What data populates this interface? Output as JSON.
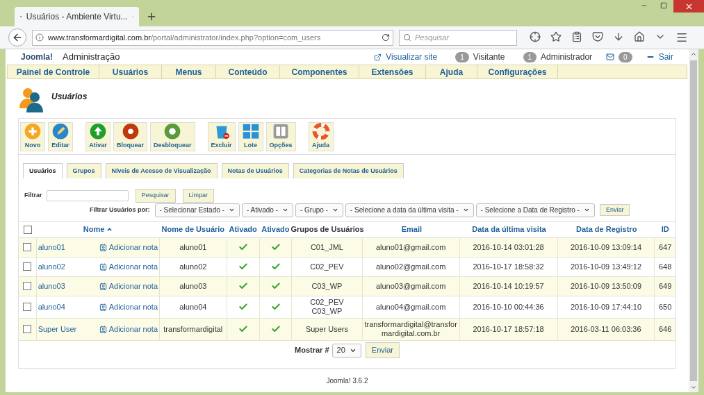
{
  "browser": {
    "tab_title": "Usuários - Ambiente Virtu...",
    "url_host": "www.transformardigital.com.br",
    "url_path": "/portal/administrator/index.php?option=com_users",
    "search_placeholder": "Pesquisar"
  },
  "header": {
    "logo": "Joomla!",
    "title": "Administração",
    "view_site": "Visualizar site",
    "visitors_count": "1",
    "visitors_label": "Visitante",
    "admins_count": "1",
    "admins_label": "Administrador",
    "messages_count": "0",
    "logout": "Sair"
  },
  "menu": [
    "Painel de Controle",
    "Usuários",
    "Menus",
    "Conteúdo",
    "Componentes",
    "Extensões",
    "Ajuda",
    "Configurações"
  ],
  "page_title": "Usuários",
  "toolbar": [
    {
      "label": "Novo",
      "kind": "new"
    },
    {
      "label": "Editar",
      "kind": "edit"
    },
    {
      "label": "Ativar",
      "kind": "activate"
    },
    {
      "label": "Bloquear",
      "kind": "block"
    },
    {
      "label": "Desbloquear",
      "kind": "unblock"
    },
    {
      "label": "Excluir",
      "kind": "delete"
    },
    {
      "label": "Lote",
      "kind": "batch"
    },
    {
      "label": "Opções",
      "kind": "options"
    },
    {
      "label": "Ajuda",
      "kind": "help"
    }
  ],
  "tabs": [
    {
      "label": "Usuários",
      "selected": true
    },
    {
      "label": "Grupos",
      "selected": false
    },
    {
      "label": "Níveis de Acesso de Visualização",
      "selected": false
    },
    {
      "label": "Notas de Usuários",
      "selected": false
    },
    {
      "label": "Categorias de Notas de Usuários",
      "selected": false
    }
  ],
  "filter": {
    "label": "Filtrar",
    "search_button": "Pesquisar",
    "clear_button": "Limpar",
    "by_label": "Filtrar Usuários por:",
    "selects": [
      "- Selecionar Estado -",
      "- Ativado -",
      "- Grupo -",
      "- Selecione a data da última visita -",
      "- Selecione a Data de Registro -"
    ],
    "submit": "Enviar"
  },
  "table": {
    "all_checked": false,
    "columns": [
      {
        "label": "Nome",
        "sorted": true
      },
      {
        "label": "Nome de Usuário",
        "sorted": false
      },
      {
        "label": "Ativado",
        "sorted": false
      },
      {
        "label": "Ativado",
        "sorted": false
      },
      {
        "label": "Grupos de Usuários",
        "sorted": false
      },
      {
        "label": "Email",
        "sorted": false
      },
      {
        "label": "Data da última visita",
        "sorted": false
      },
      {
        "label": "Data de Registro",
        "sorted": false
      },
      {
        "label": "ID",
        "sorted": false
      }
    ],
    "rows": [
      {
        "checked": false,
        "name": "aluno01",
        "note": "Adicionar nota",
        "username": "aluno01",
        "enabled": true,
        "activated": true,
        "groups": [
          "C01_JML"
        ],
        "email": "aluno01@gmail.com",
        "last_visit": "2016-10-14 03:01:28",
        "registered": "2016-10-09 13:09:14",
        "id": "647"
      },
      {
        "checked": false,
        "name": "aluno02",
        "note": "Adicionar nota",
        "username": "aluno02",
        "enabled": true,
        "activated": true,
        "groups": [
          "C02_PEV"
        ],
        "email": "aluno02@gmail.com",
        "last_visit": "2016-10-17 18:58:32",
        "registered": "2016-10-09 13:49:12",
        "id": "648"
      },
      {
        "checked": false,
        "name": "aluno03",
        "note": "Adicionar nota",
        "username": "aluno03",
        "enabled": true,
        "activated": true,
        "groups": [
          "C03_WP"
        ],
        "email": "aluno03@gmail.com",
        "last_visit": "2016-10-14 10:19:57",
        "registered": "2016-10-09 13:50:09",
        "id": "649"
      },
      {
        "checked": false,
        "name": "aluno04",
        "note": "Adicionar nota",
        "username": "aluno04",
        "enabled": true,
        "activated": true,
        "groups": [
          "C02_PEV",
          "C03_WP"
        ],
        "email": "aluno04@gmail.com",
        "last_visit": "2016-10-10 00:44:36",
        "registered": "2016-10-09 17:44:10",
        "id": "650"
      },
      {
        "checked": false,
        "name": "Super User",
        "note": "Adicionar nota",
        "username": "transformardigital",
        "enabled": true,
        "activated": true,
        "groups": [
          "Super Users"
        ],
        "email": "transformardigital@transformardigital.com.br",
        "last_visit": "2016-10-17 18:57:18",
        "registered": "2016-03-11 06:03:36",
        "id": "646"
      }
    ]
  },
  "pagination": {
    "label": "Mostrar #",
    "value": "20",
    "submit": "Enviar"
  },
  "footer": "Joomla! 3.6.2"
}
